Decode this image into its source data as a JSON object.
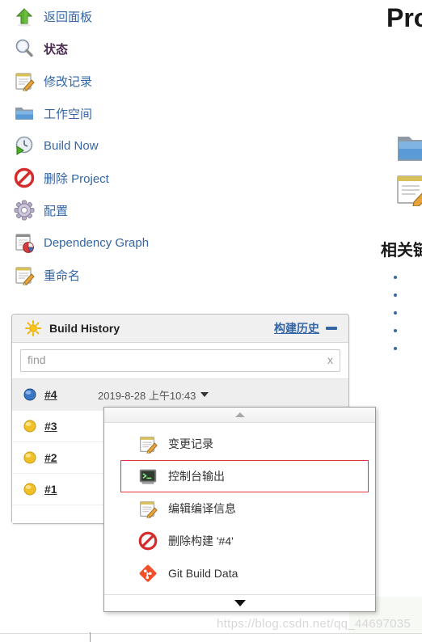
{
  "sidebar": {
    "items": [
      {
        "label": "返回面板",
        "icon": "green-up-arrow-icon",
        "current": false
      },
      {
        "label": "状态",
        "icon": "magnifier-icon",
        "current": true
      },
      {
        "label": "修改记录",
        "icon": "notepad-pencil-icon",
        "current": false
      },
      {
        "label": "工作空间",
        "icon": "folder-icon",
        "current": false
      },
      {
        "label": "Build Now",
        "icon": "clock-play-icon",
        "current": false
      },
      {
        "label": "删除 Project",
        "icon": "no-entry-icon",
        "current": false
      },
      {
        "label": "配置",
        "icon": "gear-icon",
        "current": false
      },
      {
        "label": "Dependency Graph",
        "icon": "chart-pie-icon",
        "current": false
      },
      {
        "label": "重命名",
        "icon": "notepad-pencil-icon",
        "current": false
      }
    ]
  },
  "build_history": {
    "title": "Build History",
    "title_zh": "构建历史",
    "collapse_label": "—",
    "search": {
      "placeholder": "find",
      "value": "",
      "clear_label": "x"
    },
    "rows": [
      {
        "number": "#4",
        "status": "blue-ball",
        "date": "2019-8-28 上午10:43",
        "selected": true
      },
      {
        "number": "#3",
        "status": "yellow-ball",
        "date": "",
        "selected": false
      },
      {
        "number": "#2",
        "status": "yellow-ball",
        "date": "",
        "selected": false
      },
      {
        "number": "#1",
        "status": "yellow-ball",
        "date": "",
        "selected": false
      }
    ]
  },
  "context_menu": {
    "scroll_up": "▲",
    "scroll_down": "▼",
    "items": [
      {
        "label": "变更记录",
        "icon": "notepad-pencil-icon",
        "highlighted": false
      },
      {
        "label": "控制台输出",
        "icon": "terminal-icon",
        "highlighted": true
      },
      {
        "label": "编辑编译信息",
        "icon": "notepad-pencil-icon",
        "highlighted": false
      },
      {
        "label": "删除构建 '#4'",
        "icon": "no-entry-icon",
        "highlighted": false
      },
      {
        "label": "Git Build Data",
        "icon": "git-icon",
        "highlighted": false
      }
    ],
    "highlight_color": "#e4323a"
  },
  "main": {
    "title": "Pro",
    "related_title": "相关链",
    "related_links": [
      "",
      "",
      "",
      "",
      ""
    ]
  },
  "watermark": {
    "text": "https://blog.csdn.net/qq_44697035"
  },
  "colors": {
    "link": "#3465a4",
    "visited": "#4b2a51",
    "panel_header": "#f0f0f0",
    "selected_row": "#eeeeee",
    "git_orange": "#f34f29",
    "highlight_red": "#e4323a"
  }
}
